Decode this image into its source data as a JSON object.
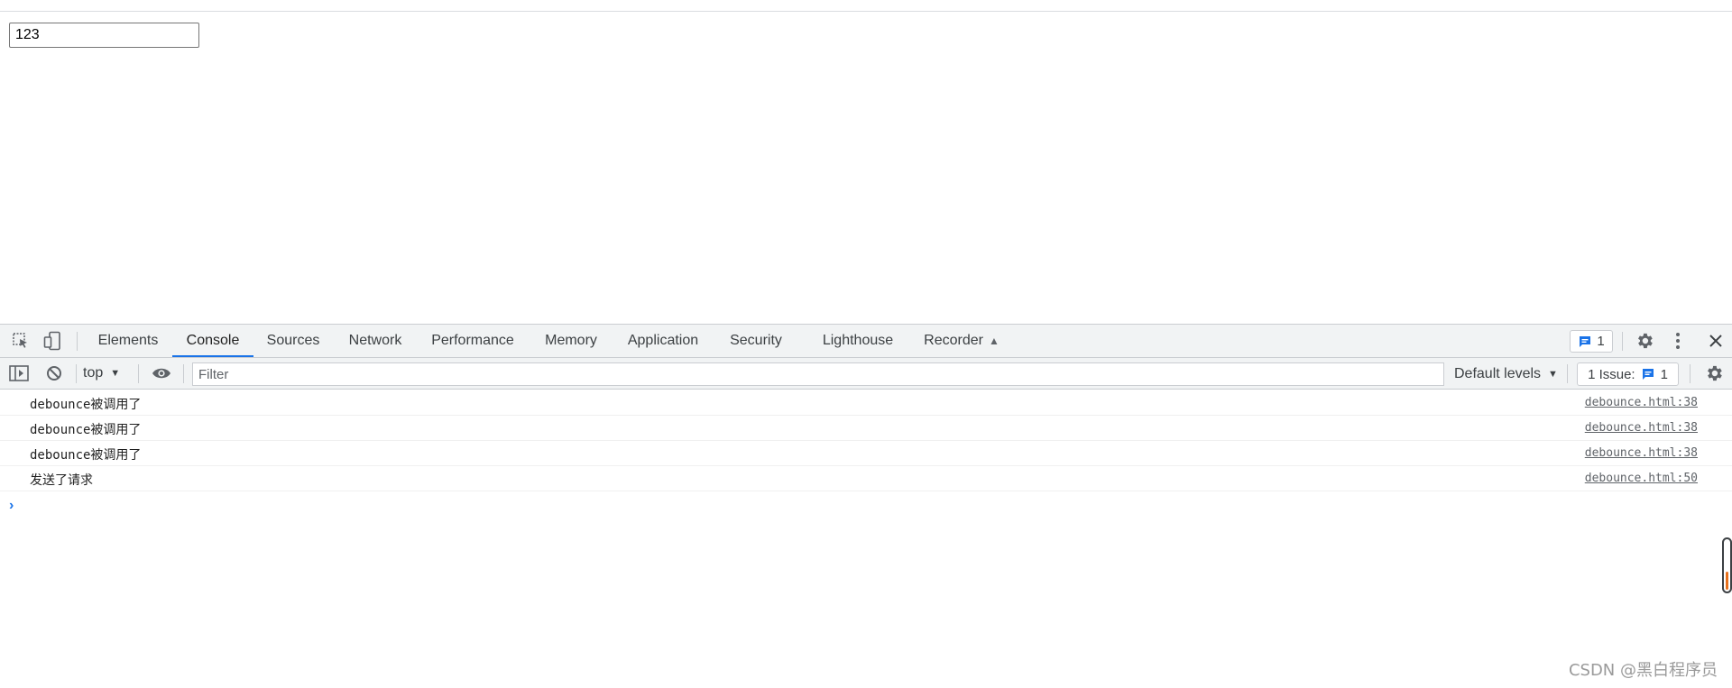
{
  "page": {
    "input_value": "123"
  },
  "devtools": {
    "tabs": [
      {
        "label": "Elements"
      },
      {
        "label": "Console"
      },
      {
        "label": "Sources"
      },
      {
        "label": "Network"
      },
      {
        "label": "Performance"
      },
      {
        "label": "Memory"
      },
      {
        "label": "Application"
      },
      {
        "label": "Security"
      },
      {
        "label": "Lighthouse"
      },
      {
        "label": "Recorder"
      }
    ],
    "active_tab": "Console",
    "message_count": "1",
    "toolbar": {
      "context": "top",
      "filter_placeholder": "Filter",
      "levels": "Default levels",
      "issues_label": "1 Issue:",
      "issues_count": "1"
    },
    "console": {
      "messages": [
        {
          "text": "debounce被调用了",
          "source": "debounce.html:38"
        },
        {
          "text": "debounce被调用了",
          "source": "debounce.html:38"
        },
        {
          "text": "debounce被调用了",
          "source": "debounce.html:38"
        },
        {
          "text": "发送了请求",
          "source": "debounce.html:50"
        }
      ],
      "prompt": "›"
    },
    "colors": {
      "accent": "#1a73e8",
      "toolbar_bg": "#f1f3f4",
      "border": "#cacdd1"
    }
  },
  "scroll_widget": {
    "fill_percent": 34
  },
  "watermark": "CSDN @黑白程序员"
}
